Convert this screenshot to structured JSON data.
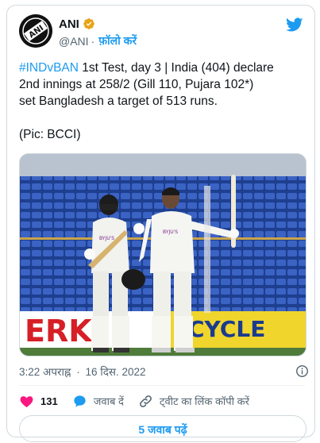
{
  "author": {
    "name": "ANI",
    "handle": "@ANI",
    "separator": "·",
    "follow_label": "फ़ॉलो करें",
    "avatar_text": "ANI"
  },
  "tweet": {
    "hashtag": "#INDvBAN",
    "line1_rest": " 1st Test, day 3 | India (404) declare",
    "line2": "2nd innings at 258/2 (Gill 110, Pujara 102*)",
    "line3": "set Bangladesh a target of 513 runs.",
    "pic_credit": "(Pic: BCCI)"
  },
  "media": {
    "banner_left": "ERK",
    "banner_right": "CYCLE",
    "sponsor": "BYJU'S"
  },
  "meta": {
    "time": "3:22 अपराह्न",
    "separator": "·",
    "date": "16 दिस. 2022"
  },
  "actions": {
    "like_count": "131",
    "reply_label": "जवाब दें",
    "copy_link_label": "ट्वीट का लिंक कॉपी करें"
  },
  "replies_button": "5 जवाब पढ़ें",
  "colors": {
    "accent": "#1d9bf0",
    "like": "#f91880",
    "text": "#0f1419",
    "muted": "#536471"
  },
  "icons": [
    "verified-badge-icon",
    "twitter-bird-icon",
    "info-icon",
    "heart-icon",
    "reply-bubble-icon",
    "link-icon"
  ]
}
